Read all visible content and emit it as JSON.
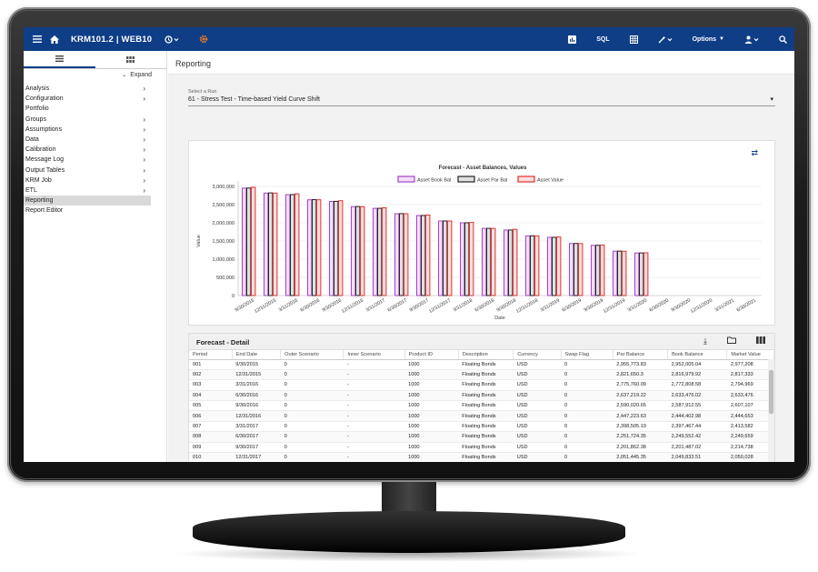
{
  "header": {
    "title": "KRM101.2 | WEB10",
    "sql_label": "SQL",
    "options_label": "Options"
  },
  "sidebar": {
    "expand_label": "Expand",
    "items": [
      {
        "label": "Analysis",
        "chevron": true
      },
      {
        "label": "Configuration",
        "chevron": true
      },
      {
        "label": "Portfolio",
        "chevron": false
      },
      {
        "label": "Groups",
        "chevron": true
      },
      {
        "label": "Assumptions",
        "chevron": true
      },
      {
        "label": "Data",
        "chevron": true
      },
      {
        "label": "Calibration",
        "chevron": true
      },
      {
        "label": "Message Log",
        "chevron": true
      },
      {
        "label": "Output Tables",
        "chevron": true
      },
      {
        "label": "KRM Job",
        "chevron": true
      },
      {
        "label": "ETL",
        "chevron": true
      },
      {
        "label": "Reporting",
        "chevron": false,
        "selected": true
      },
      {
        "label": "Report Editor",
        "chevron": false
      }
    ]
  },
  "main": {
    "page_title": "Reporting",
    "run_label": "Select a Run",
    "run_value": "61 - Stress Test - Time-based Yield Curve Shift"
  },
  "chart_data": {
    "type": "bar",
    "title": "Forecast - Asset Balances, Values",
    "xlabel": "Date",
    "ylabel": "Value",
    "ylim": [
      0,
      3000000
    ],
    "yticks": [
      "0",
      "500,000",
      "1,000,000",
      "1,500,000",
      "2,000,000",
      "2,500,000",
      "3,000,000"
    ],
    "categories": [
      "9/30/2015",
      "12/31/2015",
      "3/31/2016",
      "6/30/2016",
      "9/30/2016",
      "12/31/2016",
      "3/31/2017",
      "6/30/2017",
      "9/30/2017",
      "12/31/2017",
      "3/31/2018",
      "6/30/2018",
      "9/30/2018",
      "12/31/2018",
      "3/31/2019",
      "6/30/2019",
      "9/30/2019",
      "12/31/2019",
      "3/31/2020",
      "6/30/2020",
      "9/30/2020",
      "12/31/2020",
      "3/31/2021",
      "6/30/2021"
    ],
    "series": [
      {
        "name": "Asset Book Bal",
        "color": "#a640c8",
        "fill": "#f3dff7",
        "values": [
          2952000,
          2817000,
          2773000,
          2633000,
          2588000,
          2444000,
          2397000,
          2250000,
          2201000,
          2050000,
          2000000,
          1846000,
          1800000,
          1640000,
          1600000,
          1430000,
          1380000,
          1220000,
          1170000,
          null,
          null,
          null,
          null,
          null
        ]
      },
      {
        "name": "Asset Par Bal",
        "color": "#222222",
        "fill": "#e0e0e0",
        "values": [
          2956000,
          2822000,
          2776000,
          2637000,
          2590000,
          2447000,
          2398000,
          2252000,
          2202000,
          2051000,
          2001000,
          1848000,
          1802000,
          1642000,
          1602000,
          1432000,
          1382000,
          1222000,
          1172000,
          null,
          null,
          null,
          null,
          null
        ]
      },
      {
        "name": "Asset Value",
        "color": "#e03030",
        "fill": "#fbdede",
        "values": [
          2977000,
          2817000,
          2795000,
          2633000,
          2607000,
          2444000,
          2414000,
          2250000,
          2214000,
          2050000,
          2010000,
          1846000,
          1820000,
          1640000,
          1610000,
          1430000,
          1390000,
          1220000,
          1175000,
          null,
          null,
          null,
          null,
          null
        ]
      }
    ]
  },
  "detail": {
    "title": "Forecast - Detail",
    "columns": [
      "Period",
      "End Date",
      "Outer Scenario",
      "Inner Scenario",
      "Product ID",
      "Description",
      "Currency",
      "Swap Flag",
      "Par Balance",
      "Book Balance",
      "Market Value"
    ],
    "rows": [
      [
        "001",
        "9/30/2015",
        "0",
        "-",
        "1000",
        "Floating Bonds",
        "USD",
        "0",
        "2,955,773.83",
        "2,952,005.04",
        "2,977,208"
      ],
      [
        "002",
        "12/31/2015",
        "0",
        "-",
        "1000",
        "Floating Bonds",
        "USD",
        "0",
        "2,821,650.3",
        "2,816,979.92",
        "2,817,333"
      ],
      [
        "003",
        "3/31/2016",
        "0",
        "-",
        "1000",
        "Floating Bonds",
        "USD",
        "0",
        "2,775,760.09",
        "2,772,808.58",
        "2,794,969"
      ],
      [
        "004",
        "6/30/2016",
        "0",
        "-",
        "1000",
        "Floating Bonds",
        "USD",
        "0",
        "2,637,219.22",
        "2,633,476.02",
        "2,633,476"
      ],
      [
        "005",
        "9/30/2016",
        "0",
        "-",
        "1000",
        "Floating Bonds",
        "USD",
        "0",
        "2,590,020.65",
        "2,587,912.55",
        "2,607,107"
      ],
      [
        "006",
        "12/31/2016",
        "0",
        "-",
        "1000",
        "Floating Bonds",
        "USD",
        "0",
        "2,447,223.63",
        "2,444,402.98",
        "2,444,653"
      ],
      [
        "007",
        "3/31/2017",
        "0",
        "-",
        "1000",
        "Floating Bonds",
        "USD",
        "0",
        "2,398,505.19",
        "2,397,467.44",
        "2,413,582"
      ],
      [
        "008",
        "6/30/2017",
        "0",
        "-",
        "1000",
        "Floating Bonds",
        "USD",
        "0",
        "2,251,724.35",
        "2,249,552.42",
        "2,249,659"
      ],
      [
        "009",
        "9/30/2017",
        "0",
        "-",
        "1000",
        "Floating Bonds",
        "USD",
        "0",
        "2,201,862.38",
        "2,201,487.02",
        "2,214,738"
      ],
      [
        "010",
        "12/31/2017",
        "0",
        "-",
        "1000",
        "Floating Bonds",
        "USD",
        "0",
        "2,051,445.35",
        "2,049,833.51",
        "2,050,028"
      ],
      [
        "011",
        "3/31/2018",
        "0",
        "-",
        "1000",
        "Floating Bonds",
        "USD",
        "0",
        "2,000,622.8",
        "1,998,520.96",
        "2,010,375"
      ],
      [
        "012",
        "6/30/2018",
        "0",
        "-",
        "1000",
        "Floating Bonds",
        "USD",
        "0",
        "1,847,554.67",
        "1,846,269.03",
        "1,846,269"
      ]
    ]
  }
}
